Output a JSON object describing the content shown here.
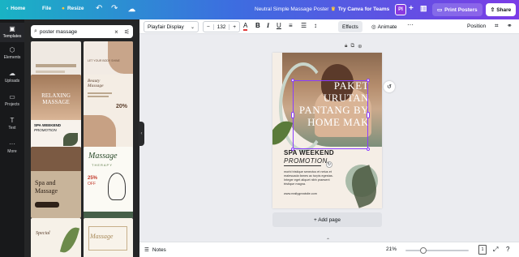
{
  "topbar": {
    "home": "Home",
    "file": "File",
    "resize": "Resize",
    "title": "Neutral Simple Massage Poster",
    "try_teams": "Try Canva for Teams",
    "avatar_initials": "PI",
    "print": "Print Posters",
    "share": "Share"
  },
  "rail": {
    "items": [
      {
        "label": "Templates",
        "icon": "layout-icon"
      },
      {
        "label": "Elements",
        "icon": "shapes-icon"
      },
      {
        "label": "Uploads",
        "icon": "cloud-upload-icon"
      },
      {
        "label": "Projects",
        "icon": "folder-icon"
      },
      {
        "label": "Text",
        "icon": "text-icon"
      },
      {
        "label": "More",
        "icon": "more-dots-icon"
      }
    ]
  },
  "search": {
    "value": "poster massage"
  },
  "thumbs": {
    "b_text": "LET YOUR BODY SHINE",
    "c_title": "RELAXING MASSAGE",
    "c_sub1": "SPA WEEKEND",
    "c_sub2": "PROMOTION",
    "d_title": "Beauty Massage",
    "d_pct": "20%",
    "e_t1": "Spa and",
    "e_t2": "Massage",
    "f_t1": "Massage",
    "f_t2": "THERAPY",
    "f_pct": "25%",
    "f_off": "OFF",
    "g_t1": "Special",
    "h_t1": "Massage"
  },
  "toolbar": {
    "font": "Playfair Display",
    "minus": "−",
    "size": "132",
    "plus": "+",
    "effects": "Effects",
    "animate": "Animate",
    "position": "Position"
  },
  "poster": {
    "headline_lines": [
      "PAKET",
      "URUTAN",
      "PANTANG BY",
      "HOME MAK"
    ],
    "spa_title": "SPA WEEKEND",
    "spa_promo": "PROMOTION",
    "body": "morbi tristique senectus et netus et malesuada fames ac turpis egestas. Integer eget aliquet nibh praesent tristique magna.",
    "website": "www.reallygreatsite.com"
  },
  "canvas": {
    "add_page": "+ Add page"
  },
  "bottombar": {
    "notes": "Notes",
    "zoom": "21%",
    "zoom_fraction": 0.26,
    "page_count": "1"
  },
  "colors": {
    "accent": "#8b3dff",
    "rail_bg": "#18191b",
    "panel_bg": "#252627"
  }
}
